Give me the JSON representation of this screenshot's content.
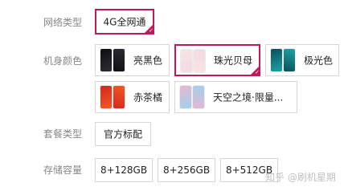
{
  "network": {
    "label": "网络类型",
    "options": [
      {
        "label": "4G全网通",
        "selected": true
      }
    ]
  },
  "color": {
    "label": "机身颜色",
    "options": [
      {
        "label": "亮黑色",
        "swatch_a": "#0f0f12",
        "swatch_b": "#2c2c34",
        "selected": false
      },
      {
        "label": "珠光贝母",
        "swatch_a": "#f6e5e2",
        "swatch_b": "#f3d9e4",
        "selected": true
      },
      {
        "label": "极光色",
        "swatch_a": "#0a4e5a",
        "swatch_b": "#1ea3a8",
        "selected": false
      },
      {
        "label": "赤茶橘",
        "swatch_a": "#d7261c",
        "swatch_b": "#f05a23",
        "selected": false
      },
      {
        "label": "天空之境·限量...",
        "swatch_a": "#e9b6cf",
        "swatch_b": "#9ed1ec",
        "selected": false
      }
    ]
  },
  "package": {
    "label": "套餐类型",
    "options": [
      {
        "label": "官方标配",
        "selected": false
      }
    ]
  },
  "storage": {
    "label": "存储容量",
    "options": [
      {
        "label": "8+128GB",
        "selected": false
      },
      {
        "label": "8+256GB",
        "selected": false
      },
      {
        "label": "8+512GB",
        "selected": false
      }
    ]
  },
  "watermark": {
    "text": "知乎 @刷机星期"
  },
  "theme": {
    "accent": "#c2185b",
    "border": "#d6d6d6",
    "label_color": "#888888"
  }
}
